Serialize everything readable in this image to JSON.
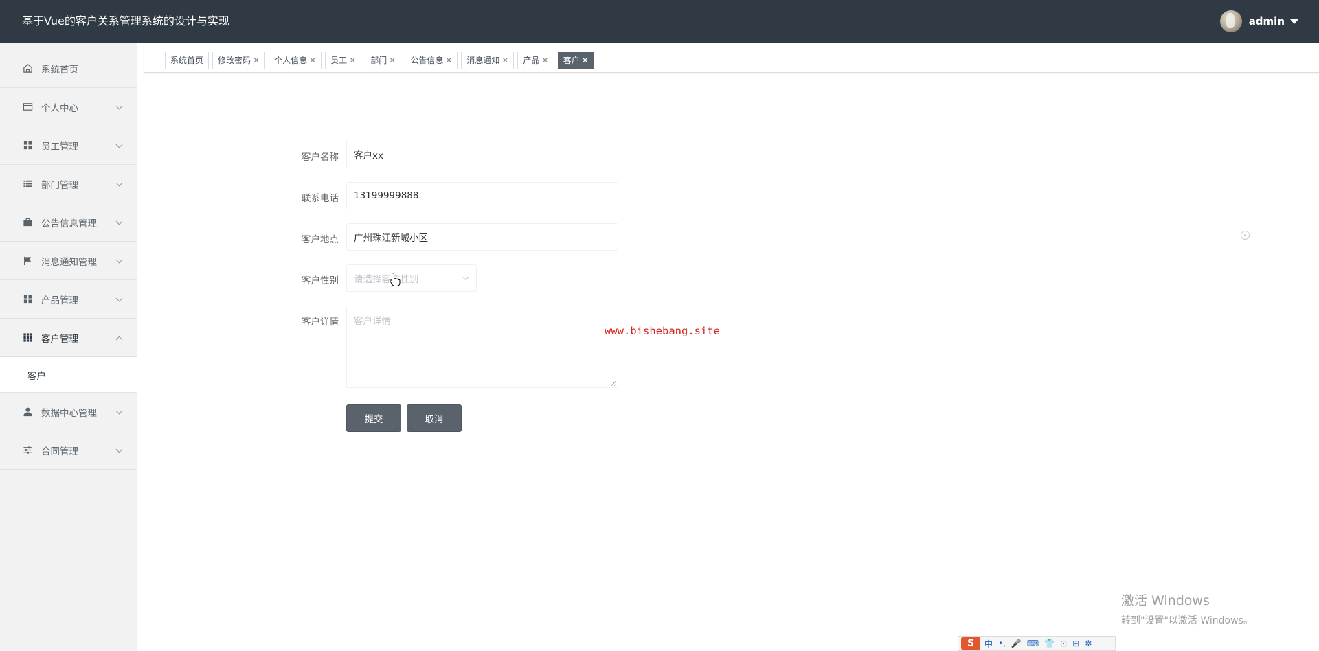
{
  "header": {
    "title": "基于Vue的客户关系管理系统的设计与实现",
    "user_name": "admin"
  },
  "sidebar": {
    "items": [
      {
        "label": "系统首页",
        "icon": "home-icon"
      },
      {
        "label": "个人中心",
        "icon": "card-icon"
      },
      {
        "label": "员工管理",
        "icon": "grid-icon"
      },
      {
        "label": "部门管理",
        "icon": "list-icon"
      },
      {
        "label": "公告信息管理",
        "icon": "briefcase-icon"
      },
      {
        "label": "消息通知管理",
        "icon": "flag-icon"
      },
      {
        "label": "产品管理",
        "icon": "grid-icon"
      },
      {
        "label": "客户管理",
        "icon": "apps-icon"
      },
      {
        "label": "数据中心管理",
        "icon": "user-icon"
      },
      {
        "label": "合同管理",
        "icon": "sliders-icon"
      }
    ],
    "submenu": {
      "label": "客户"
    }
  },
  "tags": [
    {
      "label": "系统首页",
      "closable": false
    },
    {
      "label": "修改密码",
      "closable": true
    },
    {
      "label": "个人信息",
      "closable": true
    },
    {
      "label": "员工",
      "closable": true
    },
    {
      "label": "部门",
      "closable": true
    },
    {
      "label": "公告信息",
      "closable": true
    },
    {
      "label": "消息通知",
      "closable": true
    },
    {
      "label": "产品",
      "closable": true
    },
    {
      "label": "客户",
      "closable": true,
      "active": true
    }
  ],
  "form": {
    "name_label": "客户名称",
    "name_value": "客户xx",
    "phone_label": "联系电话",
    "phone_value": "13199999888",
    "address_label": "客户地点",
    "address_value": "广州珠江新城小区",
    "gender_label": "客户性别",
    "gender_placeholder": "请选择客户性别",
    "detail_label": "客户详情",
    "detail_placeholder": "客户详情",
    "submit_label": "提交",
    "cancel_label": "取消"
  },
  "watermark": "www.bishebang.site",
  "os_overlay": {
    "activate_title": "激活 Windows",
    "activate_sub": "转到\"设置\"以激活 Windows。"
  },
  "ime": {
    "logo": "S",
    "items": [
      "中",
      "•,",
      "🎤",
      "⌨",
      "👕",
      "⊡",
      "⊞",
      "✲"
    ]
  },
  "colors": {
    "header_bg": "#2f3a44",
    "button_bg": "#5a626b",
    "watermark": "#d8231f"
  }
}
